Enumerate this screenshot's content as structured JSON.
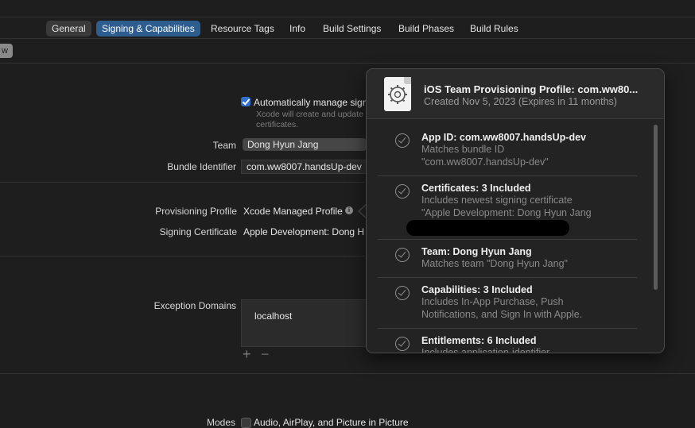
{
  "tabs": [
    {
      "label": "General"
    },
    {
      "label": "Signing & Capabilities"
    },
    {
      "label": "Resource Tags"
    },
    {
      "label": "Info"
    },
    {
      "label": "Build Settings"
    },
    {
      "label": "Build Phases"
    },
    {
      "label": "Build Rules"
    }
  ],
  "left_button_partial": "w",
  "signing": {
    "auto_manage_label": "Automatically manage sign",
    "auto_manage_note": "Xcode will create and update",
    "auto_manage_note2": "certificates.",
    "team_label": "Team",
    "team_value": "Dong Hyun Jang",
    "bundle_label": "Bundle Identifier",
    "bundle_value": "com.ww8007.handsUp-dev",
    "profile_label": "Provisioning Profile",
    "profile_value": "Xcode Managed Profile",
    "cert_label": "Signing Certificate",
    "cert_value": "Apple Development: Dong Hy"
  },
  "exceptions": {
    "label": "Exception Domains",
    "items": [
      "localhost"
    ],
    "add": "+",
    "remove": "−"
  },
  "modes": {
    "label": "Modes",
    "option": "Audio, AirPlay, and Picture in Picture"
  },
  "popover": {
    "title": "iOS Team Provisioning Profile: com.ww80...",
    "subtitle": "Created Nov 5, 2023 (Expires in 11 months)",
    "items": [
      {
        "title": "App ID: com.ww8007.handsUp-dev",
        "line1": "Matches bundle ID",
        "line2": "\"com.ww8007.handsUp-dev\""
      },
      {
        "title": "Certificates: 3 Included",
        "line1": "Includes newest signing certificate",
        "line2": "\"Apple Development: Dong Hyun Jang"
      },
      {
        "title": "Team: Dong Hyun Jang",
        "line1": "Matches team \"Dong Hyun Jang\""
      },
      {
        "title": "Capabilities: 3 Included",
        "line1": "Includes In-App Purchase, Push",
        "line2": "Notifications, and Sign In with Apple."
      },
      {
        "title": "Entitlements: 6 Included",
        "line1": "Includes application-identifier"
      }
    ]
  }
}
